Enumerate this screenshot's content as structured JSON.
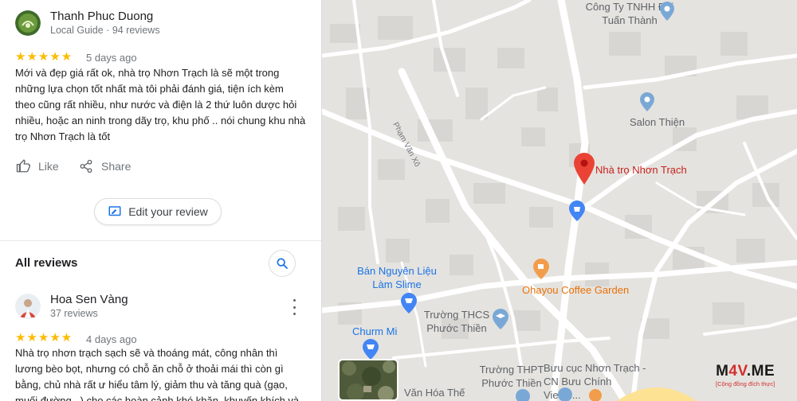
{
  "reviews_panel": {
    "first_review": {
      "author": "Thanh Phuc Duong",
      "author_meta": "Local Guide · 94 reviews",
      "stars": "★★★★★",
      "age": "5 days ago",
      "text": "Mới và đẹp giá rất ok, nhà trọ Nhơn Trạch là sẽ một trong những lựa chọn tốt nhất mà tôi phải đánh giá, tiện ích kèm theo cũng rất nhiều, như nước và điện là 2 thứ luôn dược hỏi nhiều, hoặc an ninh trong dãy trọ, khu phố .. nói chung khu nhà trọ Nhơn Trạch là tốt",
      "like_label": "Like",
      "share_label": "Share"
    },
    "edit_review_label": "Edit your review",
    "all_reviews_title": "All reviews",
    "second_review": {
      "author": "Hoa Sen Vàng",
      "author_meta": "37 reviews",
      "stars": "★★★★★",
      "age": "4 days ago",
      "text": "Nhà trọ nhơn trạch sạch sẽ và thoáng mát, công nhân thì lương bèo bọt, nhưng có chỗ ăn chỗ ở thoải mái thì còn gì bằng, chủ nhà rất ư hiểu tâm lý, giảm thu và tăng quà (gạo, muối đường...) cho các hoàn cảnh khó khăn, khuyến khích và"
    }
  },
  "map": {
    "road_label": "Phạm Văn Xô",
    "places": {
      "company": "Công Ty TNHH Đại Tuấn Thành",
      "salon": "Salon Thiện",
      "selected": "Nhà trọ Nhơn Trạch",
      "slime": "Bán Nguyên Liệu Làm Slime",
      "coffee": "Ohayou Coffee Garden",
      "thcs": "Trường THCS Phước Thiền",
      "churm": "Churm Mi",
      "thpt": "Trường THPT Phước Thiền",
      "post": "Bưu cục Nhơn Trạch - CN Bưu Chính Viettel...",
      "culture": "Văn Hóa Thế"
    },
    "colors": {
      "selected_pin": "#ea4335",
      "place_pin": "#7aa8d6",
      "shop_pin": "#4285f4",
      "food_pin": "#f29d4b"
    }
  },
  "watermark": {
    "brand_prefix": "M",
    "brand_accent": "4V",
    "brand_suffix": ".ME",
    "tagline": "[Cộng đồng đích thực]"
  }
}
